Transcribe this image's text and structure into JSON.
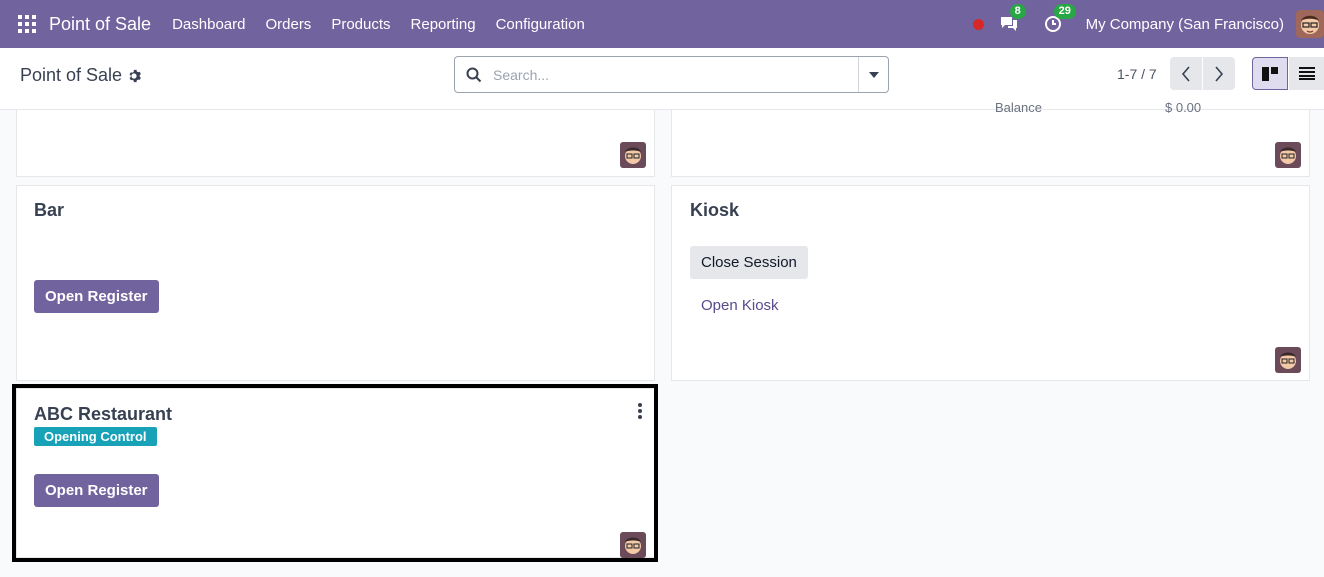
{
  "navbar": {
    "app_title": "Point of Sale",
    "menu": [
      "Dashboard",
      "Orders",
      "Products",
      "Reporting",
      "Configuration"
    ],
    "messages_count": "8",
    "activities_count": "29",
    "company": "My Company (San Francisco)"
  },
  "control": {
    "breadcrumb": "Point of Sale",
    "search_placeholder": "Search...",
    "pager": "1-7 / 7"
  },
  "cards": {
    "top_right_partial": {
      "label": "Balance",
      "value": "$ 0.00"
    },
    "bar": {
      "title": "Bar",
      "button": "Open Register"
    },
    "kiosk": {
      "title": "Kiosk",
      "button": "Close Session",
      "link": "Open Kiosk"
    },
    "abc": {
      "title": "ABC Restaurant",
      "tag": "Opening Control",
      "button": "Open Register"
    }
  },
  "colors": {
    "brand": "#71639e",
    "badge_green": "#28a745",
    "tag_teal": "#17a2b8"
  }
}
